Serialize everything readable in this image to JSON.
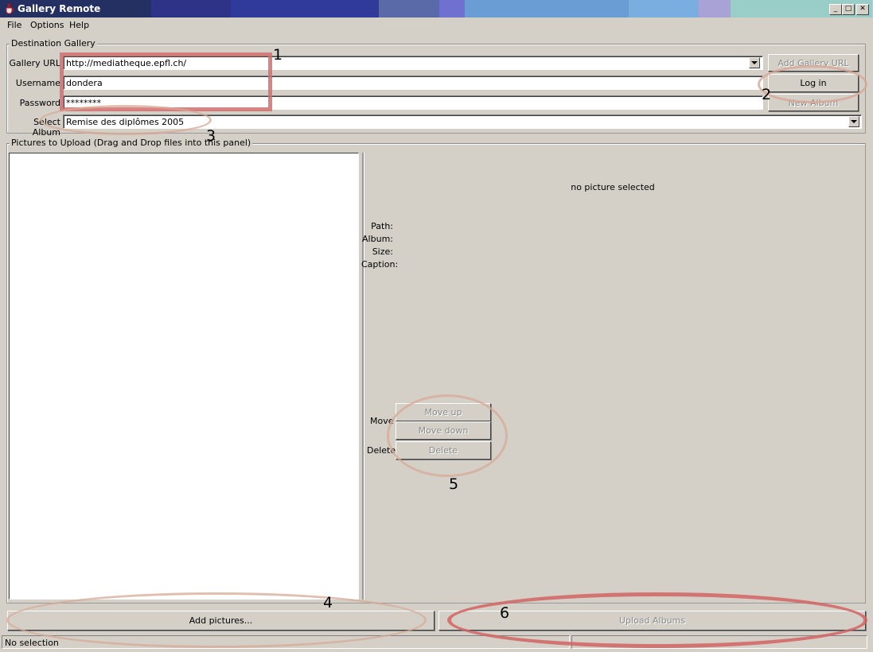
{
  "window": {
    "title": "Gallery Remote",
    "controls": {
      "minimize": "_",
      "maximize": "□",
      "close": "✕"
    },
    "gradient": [
      "#243061",
      "#2f3388",
      "#2f3a9a",
      "#3571a8",
      "#3c77b0",
      "#5a6aa8",
      "#7070d0",
      "#6a9dd4",
      "#7aaee0",
      "#a9a2d6",
      "#98cdc8",
      "#b1cdee"
    ]
  },
  "menu": [
    "File",
    "Options",
    "Help"
  ],
  "destination": {
    "group_title": "Destination Gallery",
    "url_label": "Gallery URL",
    "url_value": "http://mediatheque.epfl.ch/",
    "username_label": "Username",
    "username_value": "dondera",
    "password_label": "Password",
    "password_value": "********",
    "album_label": "Select Album",
    "album_value": "Remise des diplômes 2005",
    "add_url_button": "Add Gallery URL",
    "login_button": "Log in",
    "new_album_button": "New Album"
  },
  "pictures": {
    "group_title": "Pictures to Upload (Drag and Drop files into this panel)",
    "no_selection_text": "no picture selected",
    "info_labels": {
      "path": "Path:",
      "album": "Album:",
      "size": "Size:",
      "caption": "Caption:"
    },
    "move_label": "Move",
    "delete_label": "Delete",
    "move_up_button": "Move up",
    "move_down_button": "Move down",
    "delete_button": "Delete"
  },
  "bottom": {
    "add_pictures_button": "Add pictures...",
    "upload_button": "Upload Albums",
    "status_text": "No selection"
  },
  "annotations": [
    "1",
    "2",
    "3",
    "4",
    "5",
    "6"
  ]
}
